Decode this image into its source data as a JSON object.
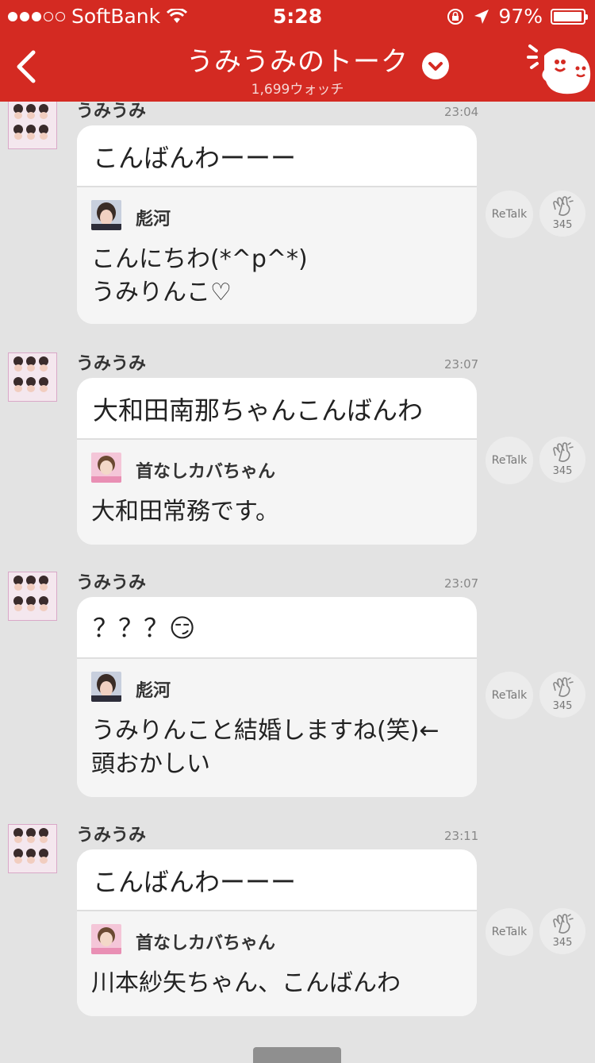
{
  "status_bar": {
    "carrier": "SoftBank",
    "time": "5:28",
    "battery_percent": "97%",
    "battery_level": 0.97,
    "signal_bars": 3
  },
  "header": {
    "title": "うみうみのトーク",
    "watch_count": "1,699ウォッチ",
    "icons": [
      "back-arrow-icon",
      "chevron-down-icon",
      "mascot-icon"
    ]
  },
  "posts": [
    {
      "author": "うみうみ",
      "time": "23:04",
      "message": "こんばんわーーー",
      "quote": {
        "author": "彪河",
        "text": [
          "こんにちわ(*^p^*)",
          "うみりんこ♡"
        ]
      },
      "retalk_label": "ReTalk",
      "clap_count": "345"
    },
    {
      "author": "うみうみ",
      "time": "23:07",
      "message": "大和田南那ちゃんこんばんわ",
      "quote": {
        "author": "首なしカバちゃん",
        "text": [
          "大和田常務です。"
        ]
      },
      "retalk_label": "ReTalk",
      "clap_count": "345"
    },
    {
      "author": "うみうみ",
      "time": "23:07",
      "message": "？？？😏",
      "quote": {
        "author": "彪河",
        "text": [
          "うみりんこと結婚しますね(笑)←",
          "頭おかしい"
        ]
      },
      "retalk_label": "ReTalk",
      "clap_count": "345"
    },
    {
      "author": "うみうみ",
      "time": "23:11",
      "message": "こんばんわーーー",
      "quote": {
        "author": "首なしカバちゃん",
        "text": [
          "川本紗矢ちゃん、こんばんわ"
        ]
      },
      "retalk_label": "ReTalk",
      "clap_count": "345"
    }
  ],
  "colors": {
    "header_red": "#d42a22",
    "background": "#e3e3e3"
  }
}
